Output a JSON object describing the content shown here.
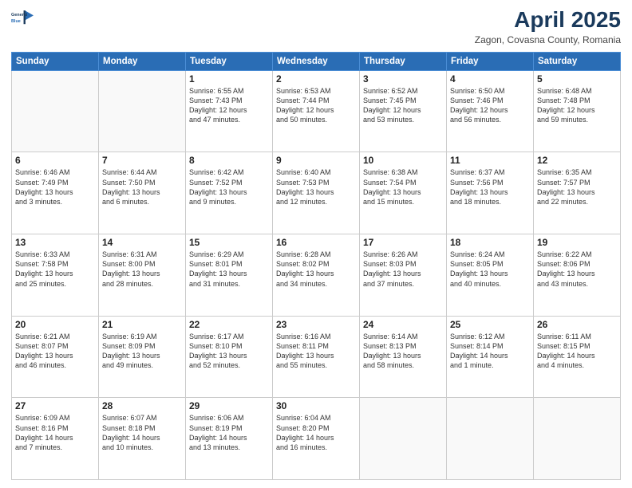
{
  "logo": {
    "line1": "General",
    "line2": "Blue"
  },
  "title": "April 2025",
  "subtitle": "Zagon, Covasna County, Romania",
  "weekdays": [
    "Sunday",
    "Monday",
    "Tuesday",
    "Wednesday",
    "Thursday",
    "Friday",
    "Saturday"
  ],
  "weeks": [
    [
      {
        "day": "",
        "info": ""
      },
      {
        "day": "",
        "info": ""
      },
      {
        "day": "1",
        "info": "Sunrise: 6:55 AM\nSunset: 7:43 PM\nDaylight: 12 hours\nand 47 minutes."
      },
      {
        "day": "2",
        "info": "Sunrise: 6:53 AM\nSunset: 7:44 PM\nDaylight: 12 hours\nand 50 minutes."
      },
      {
        "day": "3",
        "info": "Sunrise: 6:52 AM\nSunset: 7:45 PM\nDaylight: 12 hours\nand 53 minutes."
      },
      {
        "day": "4",
        "info": "Sunrise: 6:50 AM\nSunset: 7:46 PM\nDaylight: 12 hours\nand 56 minutes."
      },
      {
        "day": "5",
        "info": "Sunrise: 6:48 AM\nSunset: 7:48 PM\nDaylight: 12 hours\nand 59 minutes."
      }
    ],
    [
      {
        "day": "6",
        "info": "Sunrise: 6:46 AM\nSunset: 7:49 PM\nDaylight: 13 hours\nand 3 minutes."
      },
      {
        "day": "7",
        "info": "Sunrise: 6:44 AM\nSunset: 7:50 PM\nDaylight: 13 hours\nand 6 minutes."
      },
      {
        "day": "8",
        "info": "Sunrise: 6:42 AM\nSunset: 7:52 PM\nDaylight: 13 hours\nand 9 minutes."
      },
      {
        "day": "9",
        "info": "Sunrise: 6:40 AM\nSunset: 7:53 PM\nDaylight: 13 hours\nand 12 minutes."
      },
      {
        "day": "10",
        "info": "Sunrise: 6:38 AM\nSunset: 7:54 PM\nDaylight: 13 hours\nand 15 minutes."
      },
      {
        "day": "11",
        "info": "Sunrise: 6:37 AM\nSunset: 7:56 PM\nDaylight: 13 hours\nand 18 minutes."
      },
      {
        "day": "12",
        "info": "Sunrise: 6:35 AM\nSunset: 7:57 PM\nDaylight: 13 hours\nand 22 minutes."
      }
    ],
    [
      {
        "day": "13",
        "info": "Sunrise: 6:33 AM\nSunset: 7:58 PM\nDaylight: 13 hours\nand 25 minutes."
      },
      {
        "day": "14",
        "info": "Sunrise: 6:31 AM\nSunset: 8:00 PM\nDaylight: 13 hours\nand 28 minutes."
      },
      {
        "day": "15",
        "info": "Sunrise: 6:29 AM\nSunset: 8:01 PM\nDaylight: 13 hours\nand 31 minutes."
      },
      {
        "day": "16",
        "info": "Sunrise: 6:28 AM\nSunset: 8:02 PM\nDaylight: 13 hours\nand 34 minutes."
      },
      {
        "day": "17",
        "info": "Sunrise: 6:26 AM\nSunset: 8:03 PM\nDaylight: 13 hours\nand 37 minutes."
      },
      {
        "day": "18",
        "info": "Sunrise: 6:24 AM\nSunset: 8:05 PM\nDaylight: 13 hours\nand 40 minutes."
      },
      {
        "day": "19",
        "info": "Sunrise: 6:22 AM\nSunset: 8:06 PM\nDaylight: 13 hours\nand 43 minutes."
      }
    ],
    [
      {
        "day": "20",
        "info": "Sunrise: 6:21 AM\nSunset: 8:07 PM\nDaylight: 13 hours\nand 46 minutes."
      },
      {
        "day": "21",
        "info": "Sunrise: 6:19 AM\nSunset: 8:09 PM\nDaylight: 13 hours\nand 49 minutes."
      },
      {
        "day": "22",
        "info": "Sunrise: 6:17 AM\nSunset: 8:10 PM\nDaylight: 13 hours\nand 52 minutes."
      },
      {
        "day": "23",
        "info": "Sunrise: 6:16 AM\nSunset: 8:11 PM\nDaylight: 13 hours\nand 55 minutes."
      },
      {
        "day": "24",
        "info": "Sunrise: 6:14 AM\nSunset: 8:13 PM\nDaylight: 13 hours\nand 58 minutes."
      },
      {
        "day": "25",
        "info": "Sunrise: 6:12 AM\nSunset: 8:14 PM\nDaylight: 14 hours\nand 1 minute."
      },
      {
        "day": "26",
        "info": "Sunrise: 6:11 AM\nSunset: 8:15 PM\nDaylight: 14 hours\nand 4 minutes."
      }
    ],
    [
      {
        "day": "27",
        "info": "Sunrise: 6:09 AM\nSunset: 8:16 PM\nDaylight: 14 hours\nand 7 minutes."
      },
      {
        "day": "28",
        "info": "Sunrise: 6:07 AM\nSunset: 8:18 PM\nDaylight: 14 hours\nand 10 minutes."
      },
      {
        "day": "29",
        "info": "Sunrise: 6:06 AM\nSunset: 8:19 PM\nDaylight: 14 hours\nand 13 minutes."
      },
      {
        "day": "30",
        "info": "Sunrise: 6:04 AM\nSunset: 8:20 PM\nDaylight: 14 hours\nand 16 minutes."
      },
      {
        "day": "",
        "info": ""
      },
      {
        "day": "",
        "info": ""
      },
      {
        "day": "",
        "info": ""
      }
    ]
  ]
}
